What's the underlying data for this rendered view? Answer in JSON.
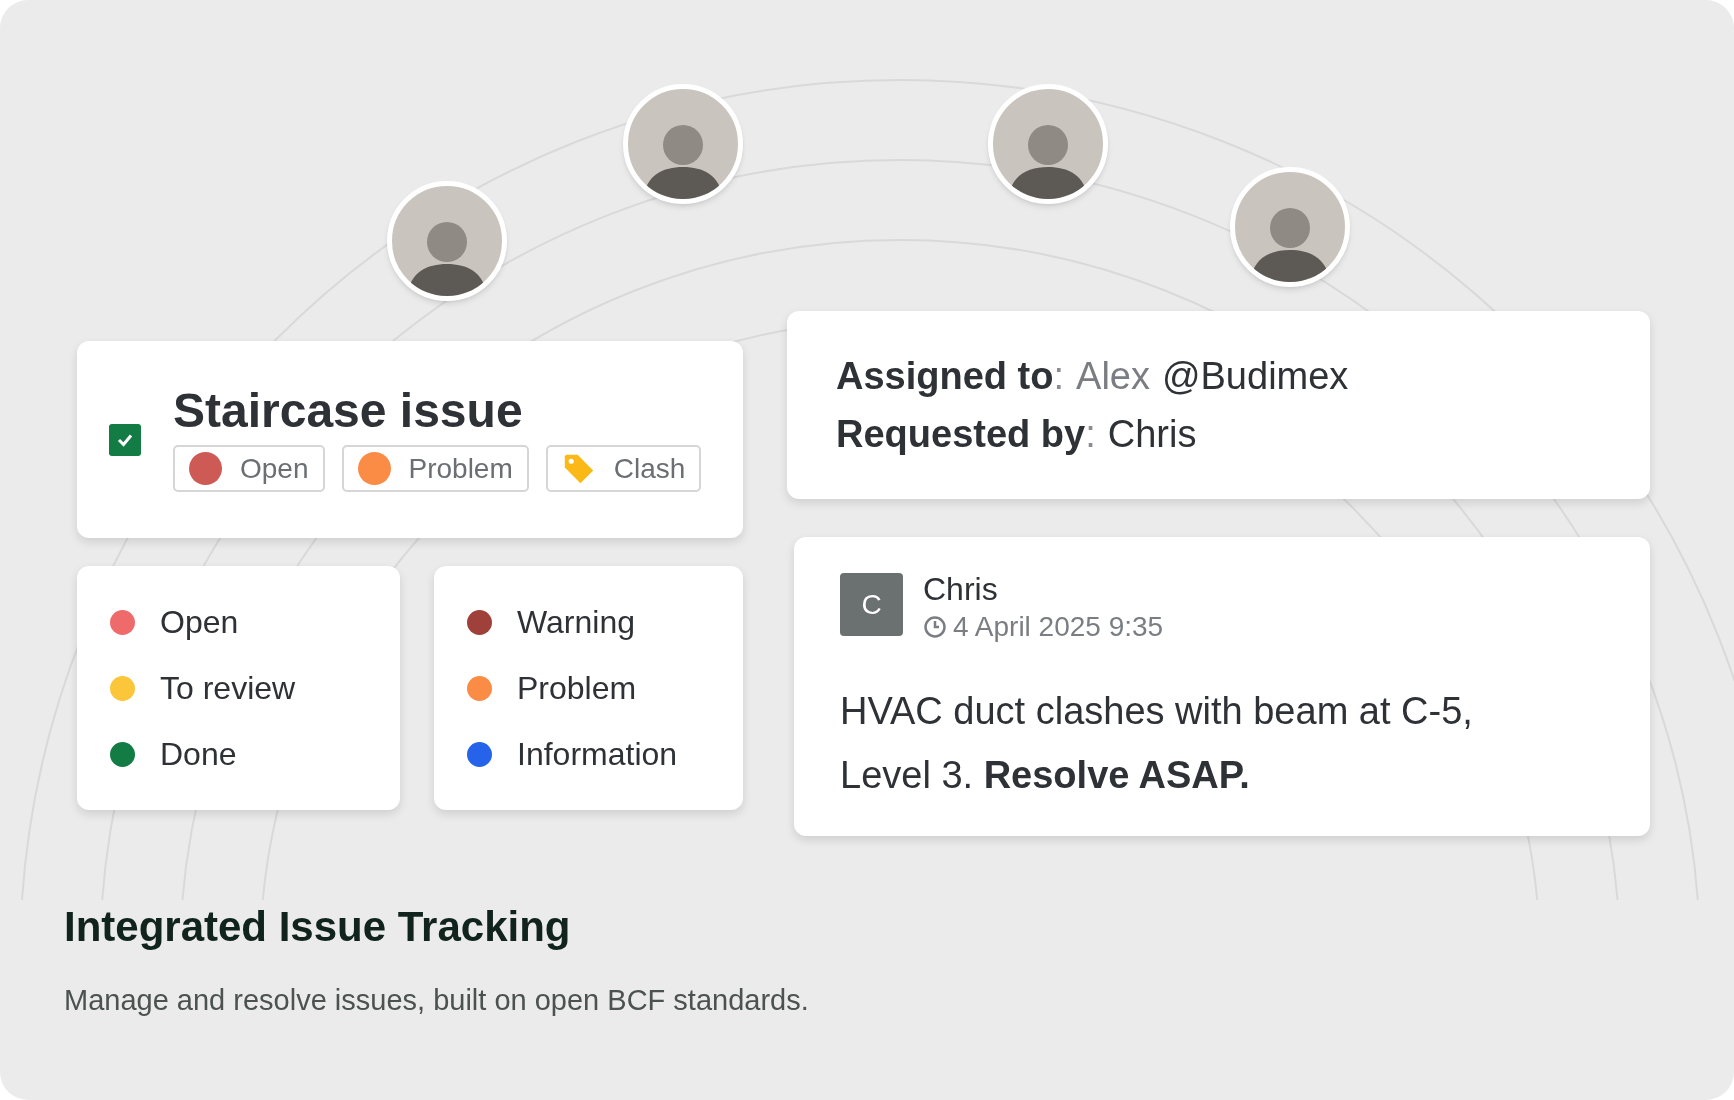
{
  "issue": {
    "checked": true,
    "title": "Staircase issue",
    "tags": [
      {
        "kind": "dot",
        "label": "Open",
        "color": "#cd5a55"
      },
      {
        "kind": "dot",
        "label": "Problem",
        "color": "#fb8c46"
      },
      {
        "kind": "tag",
        "label": "Clash",
        "color": "#fbb917"
      }
    ]
  },
  "status_legend": [
    {
      "label": "Open",
      "color": "#ef6b6b"
    },
    {
      "label": "To review",
      "color": "#fcc63a"
    },
    {
      "label": "Done",
      "color": "#127c44"
    }
  ],
  "type_legend": [
    {
      "label": "Warning",
      "color": "#a0403a"
    },
    {
      "label": "Problem",
      "color": "#fb8c46"
    },
    {
      "label": "Information",
      "color": "#2563eb"
    }
  ],
  "assignment": [
    {
      "label": "Assigned to",
      "separator": ":",
      "values": [
        {
          "text": "Alex",
          "muted": true
        },
        {
          "text": "@Budimex",
          "muted": false
        }
      ]
    },
    {
      "label": "Requested by",
      "separator": ":",
      "values": [
        {
          "text": "Chris",
          "muted": false
        }
      ]
    }
  ],
  "comment": {
    "initial": "C",
    "author": "Chris",
    "time": "4 April 2025 9:35",
    "body": "HVAC duct clashes with beam at C-5, Level 3. **Resolve ASAP.**"
  },
  "heading": "Integrated Issue Tracking",
  "description": "Manage and resolve issues, built on open BCF standards."
}
